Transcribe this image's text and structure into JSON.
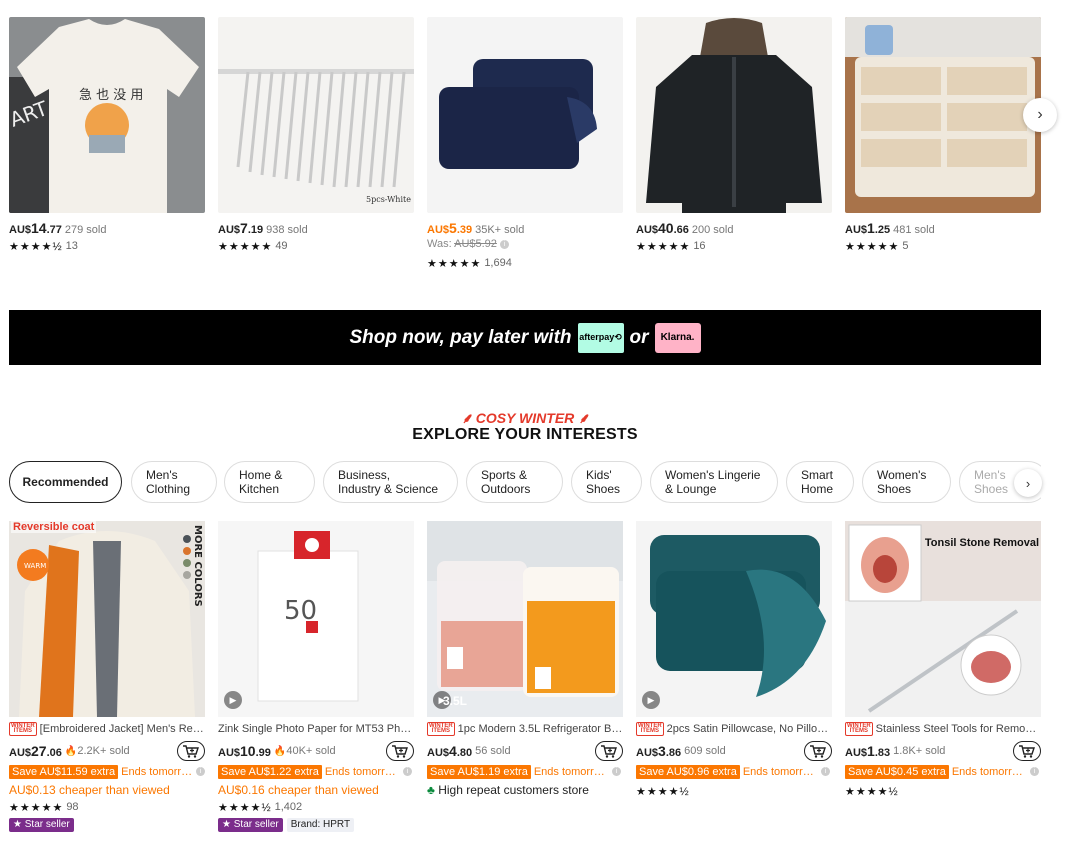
{
  "top_products": [
    {
      "currency": "AU$",
      "price_int": "14",
      "price_dec": ".77",
      "sold": "279 sold",
      "stars": "★★★★½",
      "reviews": "13",
      "image": "tshirt-image"
    },
    {
      "currency": "AU$",
      "price_int": "7",
      "price_dec": ".19",
      "sold": "938 sold",
      "stars": "★★★★★",
      "reviews": "49",
      "image": "hangers-image"
    },
    {
      "currency": "AU$",
      "price_int": "5",
      "price_dec": ".39",
      "sold": "35K+ sold",
      "was_label": "Was:",
      "was_price": "AU$5.92",
      "stars": "★★★★★",
      "reviews": "1,694",
      "image": "pillowcase-image"
    },
    {
      "currency": "AU$",
      "price_int": "40",
      "price_dec": ".66",
      "sold": "200 sold",
      "stars": "★★★★★",
      "reviews": "16",
      "image": "jacket-image"
    },
    {
      "currency": "AU$",
      "price_int": "1",
      "price_dec": ".25",
      "sold": "481 sold",
      "stars": "★★★★★",
      "reviews": "5",
      "image": "cotton-swabs-image"
    }
  ],
  "banner": {
    "text_before": "Shop now, pay later with",
    "afterpay": "afterpay⟲",
    "or": "or",
    "klarna": "Klarna."
  },
  "section": {
    "subtitle": "COSY WINTER",
    "title": "EXPLORE YOUR INTERESTS"
  },
  "tabs": [
    "Recommended",
    "Men's\nClothing",
    "Home &\nKitchen",
    "Business,\nIndustry & Science",
    "Sports &\nOutdoors",
    "Kids'\nShoes",
    "Women's Lingerie\n& Lounge",
    "Smart\nHome",
    "Women's\nShoes",
    "Men's\nShoes"
  ],
  "grid_products": [
    {
      "badge": "WINTER ITEMS",
      "title": "[Embroidered Jacket] Men's Rev...",
      "currency": "AU$",
      "price_int": "27",
      "price_dec": ".06",
      "sold": "2.2K+ sold",
      "hot": true,
      "extra": "Save AU$11.59 extra",
      "ends": "Ends tomorro...",
      "cheaper": "AU$0.13 cheaper than viewed",
      "stars": "★★★★★",
      "reviews": "98",
      "star_seller": "Star seller",
      "image_label": "Reversible coat",
      "image_side": "MORE COLORS"
    },
    {
      "badge": "",
      "title": "Zink Single Photo Paper for MT53 Phot...",
      "currency": "AU$",
      "price_int": "10",
      "price_dec": ".99",
      "sold": "40K+ sold",
      "hot": true,
      "extra": "Save AU$1.22 extra",
      "ends": "Ends tomorro...",
      "cheaper": "AU$0.16 cheaper than viewed",
      "stars": "★★★★½",
      "reviews": "1,402",
      "star_seller": "Star seller",
      "brand": "Brand: HPRT"
    },
    {
      "badge": "WINTER ITEMS",
      "title": "1pc Modern 3.5L Refrigerator Be...",
      "currency": "AU$",
      "price_int": "4",
      "price_dec": ".80",
      "sold": "56 sold",
      "hot": false,
      "extra": "Save AU$1.19 extra",
      "ends": "Ends tomorro...",
      "repeat": "High repeat customers store",
      "image_label": "3.5L"
    },
    {
      "badge": "WINTER ITEMS",
      "title": "2pcs Satin Pillowcase, No Pillow ...",
      "currency": "AU$",
      "price_int": "3",
      "price_dec": ".86",
      "sold": "609 sold",
      "hot": false,
      "extra": "Save AU$0.96 extra",
      "ends": "Ends tomorro...",
      "stars": "★★★★½"
    },
    {
      "badge": "WINTER ITEMS",
      "title": "Stainless Steel Tools for Removi...",
      "currency": "AU$",
      "price_int": "1",
      "price_dec": ".83",
      "sold": "1.8K+ sold",
      "hot": false,
      "extra": "Save AU$0.45 extra",
      "ends": "Ends tomorro...",
      "stars": "★★★★½",
      "image_label": "Tonsil Stone Removal"
    }
  ],
  "colors": {
    "accent_orange": "#fb7701",
    "heading_red": "#e4392a",
    "star_seller_purple": "#7b2d8b",
    "banner_bg": "#000000"
  }
}
